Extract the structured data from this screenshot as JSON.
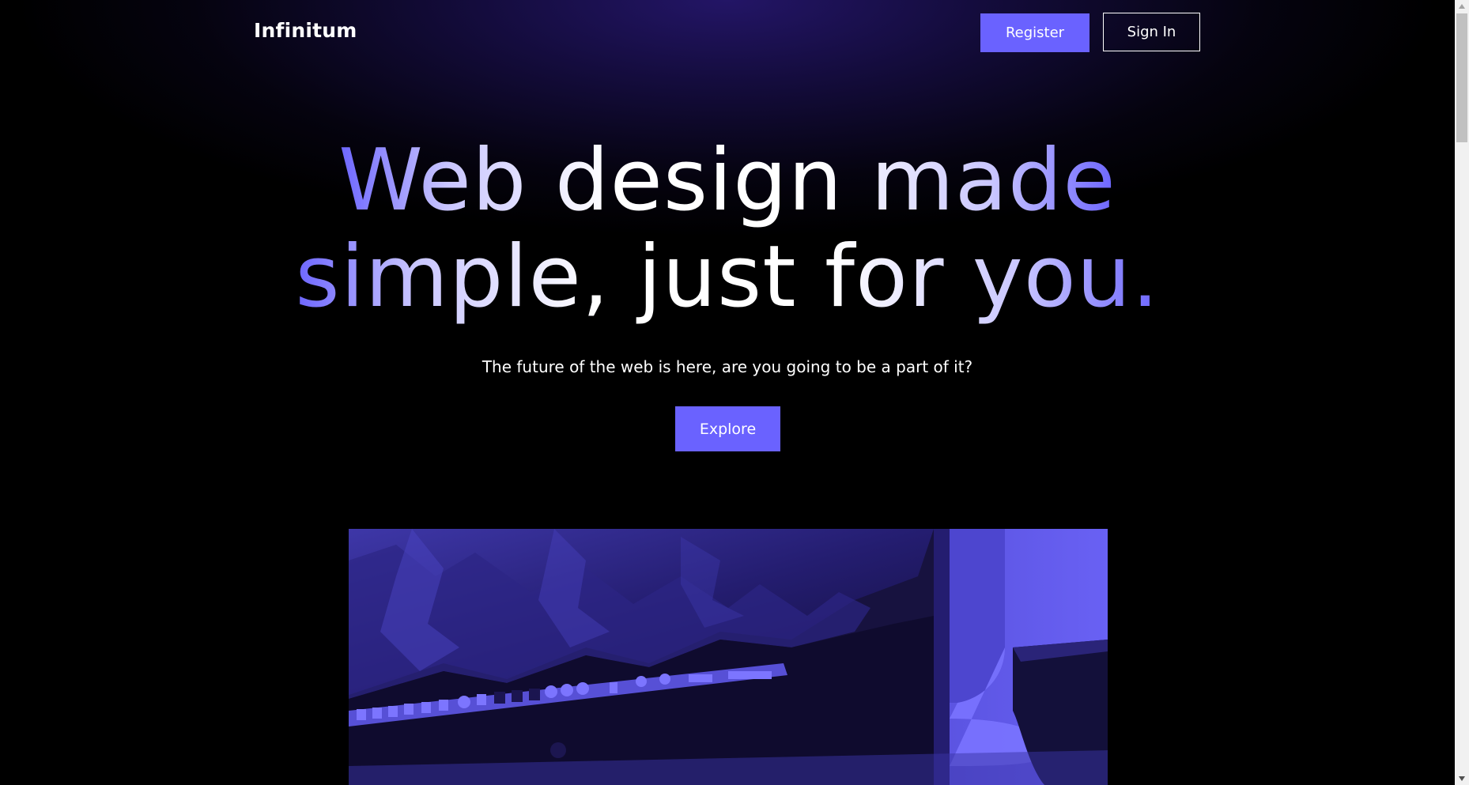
{
  "header": {
    "logo": "Infinitum",
    "register_label": "Register",
    "signin_label": "Sign In"
  },
  "hero": {
    "headline_line1": "Web design made",
    "headline_line2": "simple, just for you.",
    "subtitle": "The future of the web is here, are you going to be a part of it?",
    "explore_label": "Explore",
    "image_icon": "desktop-computer-photo"
  },
  "colors": {
    "accent": "#6a62ff",
    "background": "#000000",
    "header_glow": "#231566",
    "text": "#ffffff"
  }
}
